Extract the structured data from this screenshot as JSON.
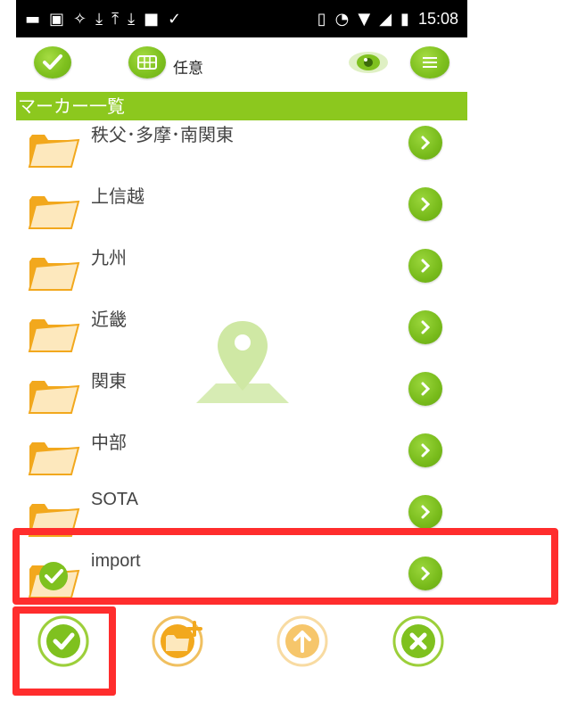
{
  "status_bar": {
    "time": "15:08",
    "left_icons": [
      "message-icon",
      "image-icon",
      "brightness-icon",
      "download-icon",
      "upload-icon",
      "download-icon",
      "square-icon",
      "check-download-icon"
    ],
    "right_icons": [
      "vibrate-icon",
      "alarm-icon",
      "wifi-icon",
      "signal-icon",
      "battery-icon"
    ]
  },
  "toolbar": {
    "grid_label": "任意"
  },
  "section": {
    "title": "マーカー一覧"
  },
  "list": {
    "items": [
      {
        "label": "秩父･多摩･南関東"
      },
      {
        "label": "上信越"
      },
      {
        "label": "九州"
      },
      {
        "label": "近畿"
      },
      {
        "label": "関東"
      },
      {
        "label": "中部"
      },
      {
        "label": "SOTA"
      },
      {
        "label": "import",
        "selected": true
      }
    ]
  },
  "bottom_bar": {
    "buttons": [
      "ok-check-icon",
      "new-folder-icon",
      "upload-arrow-icon",
      "close-x-icon"
    ]
  },
  "colors": {
    "accent_green": "#8cc81e",
    "folder_orange": "#f2a81d",
    "highlight_red": "#ff2d2d"
  }
}
